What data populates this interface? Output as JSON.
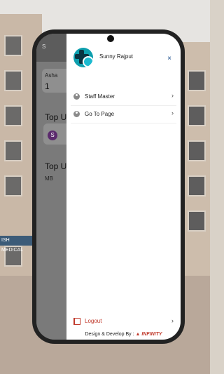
{
  "drawer": {
    "user_name": "Sunny Rajput",
    "close_icon": "×",
    "menu": [
      {
        "label": "Staff Master",
        "icon": "person-icon"
      },
      {
        "label": "Go To Page",
        "icon": "person-icon"
      }
    ],
    "logout_label": "Logout",
    "footer_text": "Design & Develop By :",
    "footer_brand": "INFINITY",
    "chevron": "›"
  },
  "background_app": {
    "header_initial": "S",
    "card_label": "Asha",
    "card_value": "1",
    "section1": "Top U",
    "section2": "Top U",
    "section2_item": "MB",
    "avatar_letter": "S"
  },
  "building_sign": "ISH MEDICAL",
  "colors": {
    "accent": "#0e9fae",
    "logout": "#c0392b",
    "close": "#1a4d8c"
  }
}
